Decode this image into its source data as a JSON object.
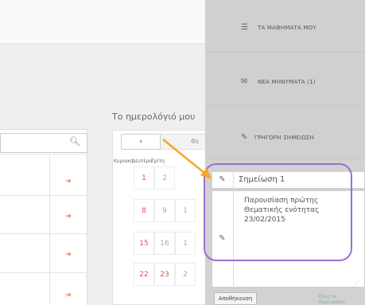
{
  "calendar": {
    "title": "Το ημερολόγιό μου",
    "prev_label": "‹",
    "next_fragment": "Φε",
    "day_names": [
      "Κυριακή",
      "Δευτέρα",
      "Τρίτη"
    ],
    "days": [
      [
        "1",
        "2"
      ],
      [
        "8",
        "9",
        "1"
      ],
      [
        "15",
        "16",
        "1"
      ],
      [
        "22",
        "23",
        "2"
      ]
    ]
  },
  "menu": {
    "items": [
      {
        "label": "ΤΑ ΜΑΘΗΜΑΤΑ ΜΟΥ",
        "icon": "list-icon"
      },
      {
        "label": "ΝΕΑ ΜΗΝΥΜΑΤΑ (1)",
        "icon": "envelope-icon"
      },
      {
        "label": "ΓΡΗΓΟΡΗ ΣΗΜΕΙΩΣΗ",
        "icon": "pencil-icon"
      }
    ]
  },
  "note": {
    "title": "Σημείωση 1",
    "body": "Παρουσίαση πρώτης\nΘεματικής ενότητας\n23/02/2015",
    "save_label": "Αποθήκευση",
    "all_notes_label": "Όλες οι σημειώσεις"
  },
  "colors": {
    "accent": "#9b6fd0",
    "arrow": "#f5a623",
    "date_red": "#d9534f"
  }
}
